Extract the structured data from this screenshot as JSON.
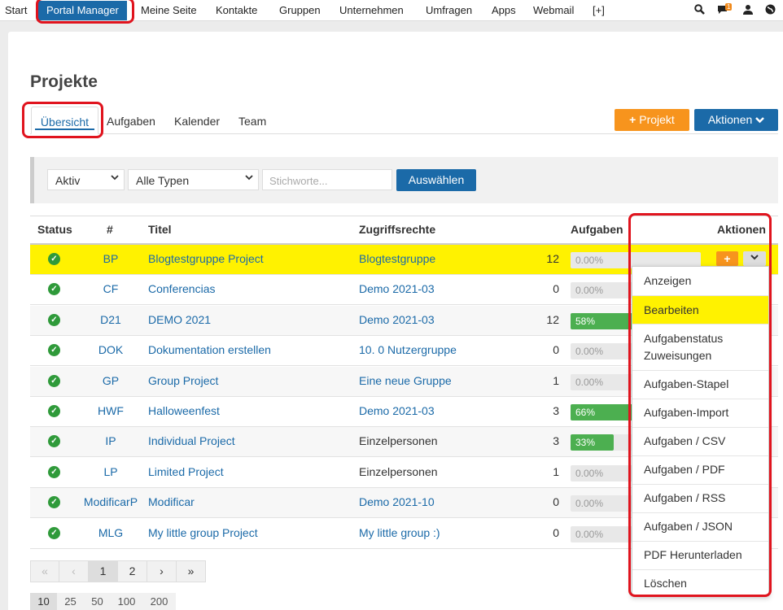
{
  "nav": {
    "items": [
      "Start",
      "Portal Manager",
      "Meine Seite",
      "Kontakte",
      "Gruppen",
      "Unternehmen",
      "Umfragen",
      "Apps",
      "Webmail",
      "[+]"
    ],
    "notification_count": "1"
  },
  "page": {
    "title": "Projekte"
  },
  "tabs": [
    "Übersicht",
    "Aufgaben",
    "Kalender",
    "Team"
  ],
  "buttons": {
    "new_project": "Projekt",
    "actions": "Aktionen"
  },
  "filters": {
    "status": "Aktiv",
    "type": "Alle Typen",
    "keywords_placeholder": "Stichworte...",
    "submit": "Auswählen"
  },
  "table": {
    "headers": [
      "Status",
      "#",
      "Titel",
      "Zugriffsrechte",
      "Aufgaben",
      "Aktionen"
    ],
    "rows": [
      {
        "code": "BP",
        "title": "Blogtestgruppe Project",
        "access": "Blogtestgruppe",
        "access_link": true,
        "tasks": "12",
        "progress": 0,
        "progress_label": "0.00%"
      },
      {
        "code": "CF",
        "title": "Conferencias",
        "access": "Demo 2021-03",
        "access_link": true,
        "tasks": "0",
        "progress": 0,
        "progress_label": "0.00%"
      },
      {
        "code": "D21",
        "title": "DEMO 2021",
        "access": "Demo 2021-03",
        "access_link": true,
        "tasks": "12",
        "progress": 58,
        "progress_label": "58%"
      },
      {
        "code": "DOK",
        "title": "Dokumentation erstellen",
        "access": "10. 0 Nutzergruppe",
        "access_link": true,
        "tasks": "0",
        "progress": 0,
        "progress_label": "0.00%"
      },
      {
        "code": "GP",
        "title": "Group Project",
        "access": "Eine neue Gruppe",
        "access_link": true,
        "tasks": "1",
        "progress": 0,
        "progress_label": "0.00%"
      },
      {
        "code": "HWF",
        "title": "Halloweenfest",
        "access": "Demo 2021-03",
        "access_link": true,
        "tasks": "3",
        "progress": 66,
        "progress_label": "66%"
      },
      {
        "code": "IP",
        "title": "Individual Project",
        "access": "Einzelpersonen",
        "access_link": false,
        "tasks": "3",
        "progress": 33,
        "progress_label": "33%"
      },
      {
        "code": "LP",
        "title": "Limited Project",
        "access": "Einzelpersonen",
        "access_link": false,
        "tasks": "1",
        "progress": 0,
        "progress_label": "0.00%"
      },
      {
        "code": "ModificarP",
        "title": "Modificar",
        "access": "Demo 2021-10",
        "access_link": true,
        "tasks": "0",
        "progress": 0,
        "progress_label": "0.00%"
      },
      {
        "code": "MLG",
        "title": "My little group Project",
        "access": "My little group :)",
        "access_link": true,
        "tasks": "0",
        "progress": 0,
        "progress_label": "0.00%"
      }
    ]
  },
  "row_actions_menu": [
    "Anzeigen",
    "Bearbeiten",
    "Aufgabenstatus Zuweisungen",
    "Aufgaben-Stapel",
    "Aufgaben-Import",
    "Aufgaben / CSV",
    "Aufgaben / PDF",
    "Aufgaben / RSS",
    "Aufgaben / JSON",
    "PDF Herunterladen",
    "Löschen"
  ],
  "pagination": {
    "first": "«",
    "prev": "‹",
    "pages": [
      "1",
      "2"
    ],
    "current": "1",
    "next": "›",
    "last": "»"
  },
  "page_sizes": [
    "10",
    "25",
    "50",
    "100",
    "200"
  ],
  "page_size_current": "10",
  "colors": {
    "accent_blue": "#1b6aa8",
    "accent_orange": "#f7941d",
    "highlight_yellow": "#fff200",
    "progress_green": "#4caf50",
    "annotation_red": "#e0141e"
  }
}
